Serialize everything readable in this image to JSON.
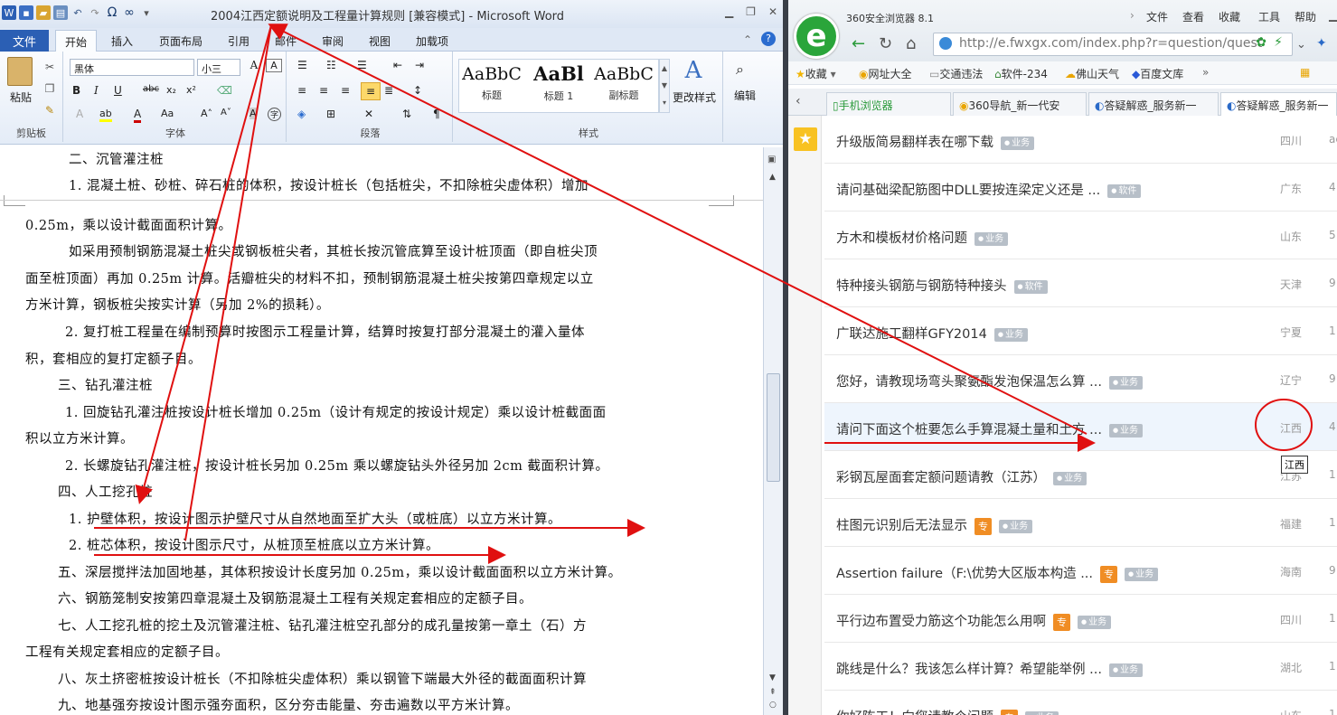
{
  "word": {
    "title": "2004江西定额说明及工程量计算规则 [兼容模式] - Microsoft Word",
    "tabs": {
      "file": "文件",
      "start": "开始",
      "insert": "插入",
      "layout": "页面布局",
      "references": "引用",
      "mailings": "邮件",
      "review": "审阅",
      "view": "视图",
      "addins": "加载项"
    },
    "ribbon": {
      "paste": "粘贴",
      "clipboard": "剪贴板",
      "font": "字体",
      "paragraph": "段落",
      "styles": "样式",
      "font_name": "黑体",
      "font_size": "小三",
      "change_styles": "更改样式",
      "edit": "编辑",
      "style1_sample": "AaBbC",
      "style1_name": "标题",
      "style2_sample": "AaBl",
      "style2_name": "标题 1",
      "style3_sample": "AaBbC",
      "style3_name": "副标题"
    },
    "paragraphs": [
      "二、沉管灌注桩",
      "1. 混凝土桩、砂桩、碎石桩的体积，按设计桩长（包括桩尖，不扣除桩尖虚体积）增加",
      "0.25m，乘以设计截面面积计算。",
      "如采用预制钢筋混凝土桩尖或钢板桩尖者，其桩长按沉管底算至设计桩顶面（即自桩尖顶",
      "面至桩顶面）再加 0.25m 计算。活瓣桩尖的材料不扣，预制钢筋混凝土桩尖按第四章规定以立",
      "方米计算，钢板桩尖按实计算（另加 2%的损耗）。",
      "2. 复打桩工程量在编制预算时按图示工程量计算，结算时按复打部分混凝土的灌入量体",
      "积，套相应的复打定额子目。",
      "三、钻孔灌注桩",
      "1. 回旋钻孔灌注桩按设计桩长增加 0.25m（设计有规定的按设计规定）乘以设计桩截面面",
      "积以立方米计算。",
      "2. 长螺旋钻孔灌注桩，按设计桩长另加 0.25m 乘以螺旋钻头外径另加 2cm 截面积计算。",
      "四、人工挖孔桩",
      "1. 护壁体积，按设计图示护壁尺寸从自然地面至扩大头（或桩底）以立方米计算。",
      "2. 桩芯体积，按设计图示尺寸，从桩顶至桩底以立方米计算。",
      "五、深层搅拌法加固地基，其体积按设计长度另加 0.25m，乘以设计截面面积以立方米计算。",
      "六、钢筋笼制安按第四章混凝土及钢筋混凝土工程有关规定套相应的定额子目。",
      "七、人工挖孔桩的挖土及沉管灌注桩、钻孔灌注桩空孔部分的成孔量按第一章土（石）方",
      "工程有关规定套相应的定额子目。",
      "八、灰土挤密桩按设计桩长（不扣除桩尖虚体积）乘以钢管下端最大外径的截面面积计算",
      "九、地基强夯按设计图示强夯面积，区分夯击能量、夯击遍数以平方米计算。"
    ]
  },
  "browser": {
    "title": "360安全浏览器 8.1",
    "menu": {
      "file": "文件",
      "view": "查看",
      "favorites": "收藏",
      "tools": "工具",
      "help": "帮助"
    },
    "url": "http://e.fwxgx.com/index.php?r=question/quest",
    "bookmarks": {
      "fav": "收藏",
      "b1": "网址大全",
      "b2": "交通违法",
      "b3": "软件-234",
      "b4": "佛山天气",
      "b5": "百度文库"
    },
    "tabs": {
      "t1": "手机浏览器",
      "t2": "360导航_新一代安",
      "t3": "答疑解惑_服务新一",
      "t4": "答疑解惑_服务新一"
    },
    "questions": [
      {
        "title": "升级版简易翻样表在哪下载",
        "badge": "业务",
        "zhuan": "",
        "prov": "四川",
        "num": "ac"
      },
      {
        "title": "请问基础梁配筋图中DLL要按连梁定义还是 ...",
        "badge": "软件",
        "zhuan": "",
        "prov": "广东",
        "num": "4"
      },
      {
        "title": "方木和模板材价格问题",
        "badge": "业务",
        "zhuan": "",
        "prov": "山东",
        "num": "5"
      },
      {
        "title": "特种接头钢筋与钢筋特种接头",
        "badge": "软件",
        "zhuan": "",
        "prov": "天津",
        "num": "9"
      },
      {
        "title": "广联达施工翻样GFY2014",
        "badge": "业务",
        "zhuan": "",
        "prov": "宁夏",
        "num": "1"
      },
      {
        "title": "您好，请教现场弯头聚氨酯发泡保温怎么算 ...",
        "badge": "业务",
        "zhuan": "",
        "prov": "辽宁",
        "num": "9"
      },
      {
        "title": "请问下面这个桩要怎么手算混凝土量和土方 ...",
        "badge": "业务",
        "zhuan": "",
        "prov": "江西",
        "num": "4"
      },
      {
        "title": "彩钢瓦屋面套定额问题请教（江苏）",
        "badge": "业务",
        "zhuan": "",
        "prov": "江苏",
        "num": "1"
      },
      {
        "title": "柱图元识别后无法显示",
        "badge": "业务",
        "zhuan": "专",
        "prov": "福建",
        "num": "1"
      },
      {
        "title": "Assertion failure（F:\\优势大区版本构造 ...",
        "badge": "业务",
        "zhuan": "专",
        "prov": "海南",
        "num": "9"
      },
      {
        "title": "平行边布置受力筋这个功能怎么用啊",
        "badge": "业务",
        "zhuan": "专",
        "prov": "四川",
        "num": "1"
      },
      {
        "title": "跳线是什么？我该怎么样计算？希望能举例 ...",
        "badge": "业务",
        "zhuan": "",
        "prov": "湖北",
        "num": "1"
      },
      {
        "title": "你好陈工！向您请教个问题",
        "badge": "业务",
        "zhuan": "专",
        "prov": "山东",
        "num": "1"
      }
    ],
    "tooltip": "江西"
  },
  "annotation_color": "#e01010"
}
